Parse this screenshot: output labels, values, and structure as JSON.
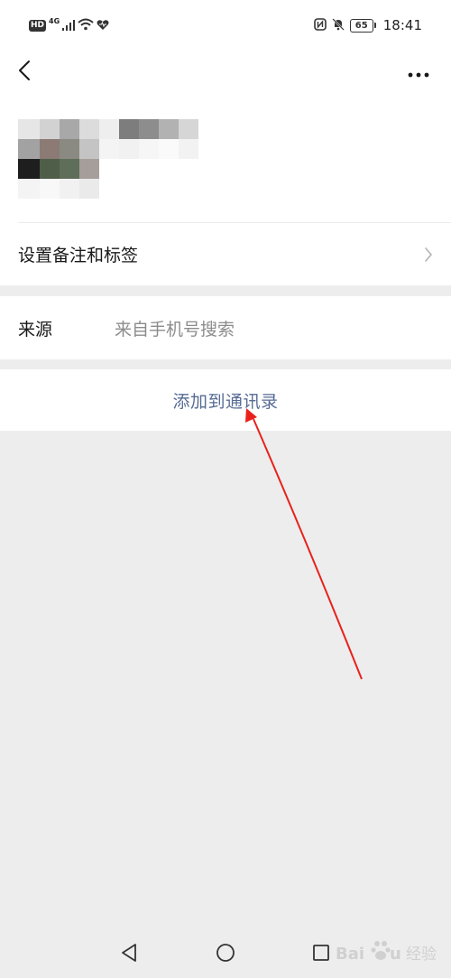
{
  "status_bar": {
    "hd_label": "HD",
    "network_label": "4G",
    "battery_level": "65",
    "time": "18:41"
  },
  "nav": {
    "back_icon": "chevron-left-icon",
    "more_icon": "more-horizontal-icon"
  },
  "rows": {
    "remark_label": "设置备注和标签",
    "source_label": "来源",
    "source_value": "来自手机号搜索",
    "add_contact_label": "添加到通讯录"
  },
  "colors": {
    "accent_link": "#576b95",
    "annotation_arrow": "#e8221b",
    "page_background": "#ededed"
  }
}
